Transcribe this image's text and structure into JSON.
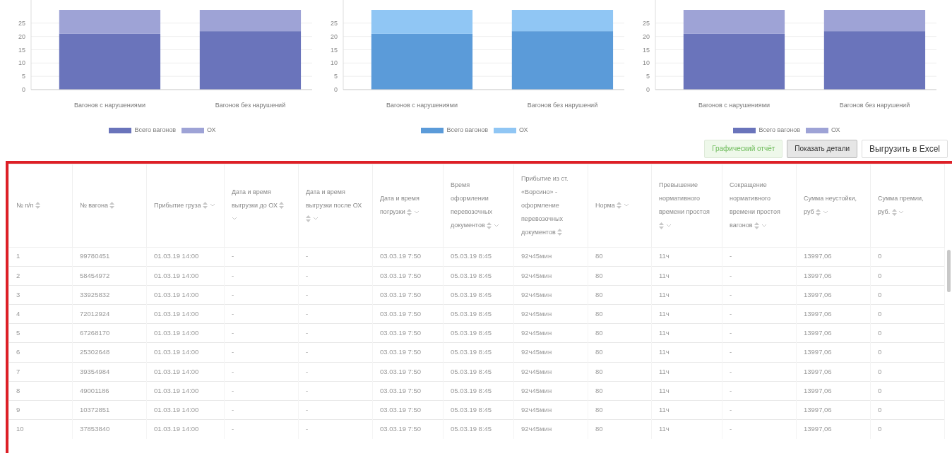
{
  "charts": [
    {
      "chart_data": {
        "type": "bar",
        "stacked": true,
        "grid": true,
        "categories": [
          "Вагонов с нарушениями",
          "Вагонов без нарушений"
        ],
        "ylim": [
          0,
          30
        ],
        "yticks": [
          0,
          5,
          10,
          15,
          20,
          25
        ],
        "series": [
          {
            "name": "Всего вагонов",
            "color": "#6a74bb",
            "values": [
              21,
              22
            ]
          },
          {
            "name": "ОХ",
            "color": "#9ea3d6",
            "values": [
              9,
              8
            ]
          }
        ]
      }
    },
    {
      "chart_data": {
        "type": "bar",
        "stacked": true,
        "grid": true,
        "categories": [
          "Вагонов с нарушениями",
          "Вагонов без нарушений"
        ],
        "ylim": [
          0,
          30
        ],
        "yticks": [
          0,
          5,
          10,
          15,
          20,
          25
        ],
        "series": [
          {
            "name": "Всего вагонов",
            "color": "#5b9bd9",
            "values": [
              21,
              22
            ]
          },
          {
            "name": "ОХ",
            "color": "#90c6f4",
            "values": [
              9,
              8
            ]
          }
        ]
      }
    },
    {
      "chart_data": {
        "type": "bar",
        "stacked": true,
        "grid": true,
        "categories": [
          "Вагонов с нарушениями",
          "Вагонов без нарушений"
        ],
        "ylim": [
          0,
          30
        ],
        "yticks": [
          0,
          5,
          10,
          15,
          20,
          25
        ],
        "series": [
          {
            "name": "Всего вагонов",
            "color": "#6a74bb",
            "values": [
              21,
              22
            ]
          },
          {
            "name": "ОХ",
            "color": "#9ea3d6",
            "values": [
              9,
              8
            ]
          }
        ]
      }
    }
  ],
  "buttons": [
    {
      "label": "Графический отчёт",
      "kind": "success"
    },
    {
      "label": "Показать детали",
      "kind": "pressed"
    },
    {
      "label": "Выгрузить в Excel",
      "kind": "default"
    }
  ],
  "table": {
    "columns": [
      {
        "label": "№ п/п",
        "sortable": true,
        "filterable": false
      },
      {
        "label": "№ вагона",
        "sortable": true,
        "filterable": false
      },
      {
        "label": "Прибытие груза",
        "sortable": true,
        "filterable": true
      },
      {
        "label": "Дата и время выгрузки до ОХ",
        "sortable": true,
        "filterable": true
      },
      {
        "label": "Дата и время выгрузки после ОХ",
        "sortable": true,
        "filterable": true
      },
      {
        "label": "Дата и время погрузки",
        "sortable": true,
        "filterable": true
      },
      {
        "label": "Время оформлении перевозочных документов",
        "sortable": true,
        "filterable": true
      },
      {
        "label": "Прибытие из ст. «Ворсино» - оформление перевозочных документов",
        "sortable": true,
        "filterable": false
      },
      {
        "label": "Норма",
        "sortable": true,
        "filterable": true
      },
      {
        "label": "Превышение нормативного времени простоя",
        "sortable": true,
        "filterable": true
      },
      {
        "label": "Сокращение нормативного времени простоя вагонов",
        "sortable": true,
        "filterable": true
      },
      {
        "label": "Сумма неустойки, руб",
        "sortable": true,
        "filterable": true
      },
      {
        "label": "Сумма премии, руб.",
        "sortable": true,
        "filterable": true
      }
    ],
    "rows": [
      [
        "1",
        "99780451",
        "01.03.19 14:00",
        "-",
        "-",
        "03.03.19 7:50",
        "05.03.19 8:45",
        "92ч45мин",
        "80",
        "11ч",
        "-",
        "13997,06",
        "0"
      ],
      [
        "2",
        "58454972",
        "01.03.19 14:00",
        "-",
        "-",
        "03.03.19 7:50",
        "05.03.19 8:45",
        "92ч45мин",
        "80",
        "11ч",
        "-",
        "13997,06",
        "0"
      ],
      [
        "3",
        "33925832",
        "01.03.19 14:00",
        "-",
        "-",
        "03.03.19 7:50",
        "05.03.19 8:45",
        "92ч45мин",
        "80",
        "11ч",
        "-",
        "13997,06",
        "0"
      ],
      [
        "4",
        "72012924",
        "01.03.19 14:00",
        "-",
        "-",
        "03.03.19 7:50",
        "05.03.19 8:45",
        "92ч45мин",
        "80",
        "11ч",
        "-",
        "13997,06",
        "0"
      ],
      [
        "5",
        "67268170",
        "01.03.19 14:00",
        "-",
        "-",
        "03.03.19 7:50",
        "05.03.19 8:45",
        "92ч45мин",
        "80",
        "11ч",
        "-",
        "13997,06",
        "0"
      ],
      [
        "6",
        "25302648",
        "01.03.19 14:00",
        "-",
        "-",
        "03.03.19 7:50",
        "05.03.19 8:45",
        "92ч45мин",
        "80",
        "11ч",
        "-",
        "13997,06",
        "0"
      ],
      [
        "7",
        "39354984",
        "01.03.19 14:00",
        "-",
        "-",
        "03.03.19 7:50",
        "05.03.19 8:45",
        "92ч45мин",
        "80",
        "11ч",
        "-",
        "13997,06",
        "0"
      ],
      [
        "8",
        "49001186",
        "01.03.19 14:00",
        "-",
        "-",
        "03.03.19 7:50",
        "05.03.19 8:45",
        "92ч45мин",
        "80",
        "11ч",
        "-",
        "13997,06",
        "0"
      ],
      [
        "9",
        "10372851",
        "01.03.19 14:00",
        "-",
        "-",
        "03.03.19 7:50",
        "05.03.19 8:45",
        "92ч45мин",
        "80",
        "11ч",
        "-",
        "13997,06",
        "0"
      ],
      [
        "10",
        "37853840",
        "01.03.19 14:00",
        "-",
        "-",
        "03.03.19 7:50",
        "05.03.19 8:45",
        "92ч45мин",
        "80",
        "11ч",
        "-",
        "13997,06",
        "0"
      ]
    ]
  }
}
